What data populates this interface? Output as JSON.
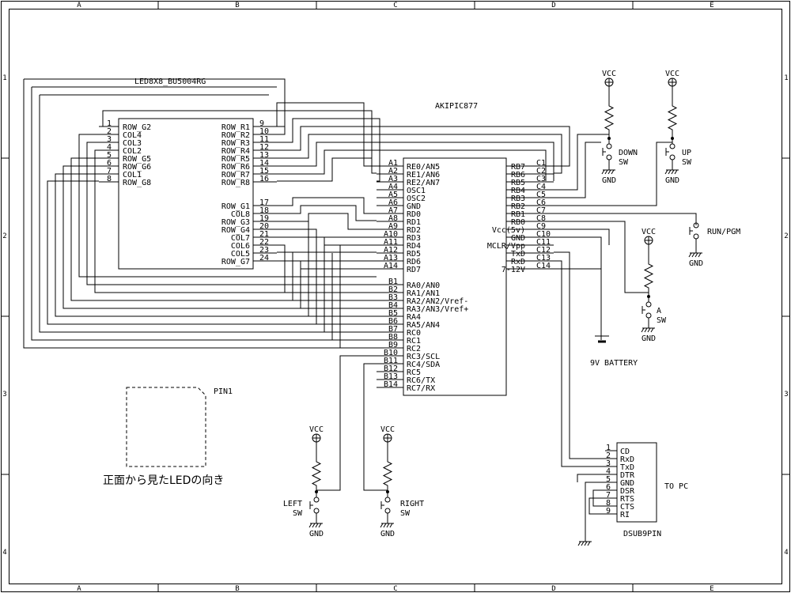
{
  "frame": {
    "cols": [
      "A",
      "B",
      "C",
      "D",
      "E"
    ],
    "rows": [
      "1",
      "2",
      "3",
      "4"
    ]
  },
  "led": {
    "title": "LED8X8_BU5004RG",
    "left_pins": [
      {
        "num": "1",
        "name": "ROW_G2"
      },
      {
        "num": "2",
        "name": "COL4"
      },
      {
        "num": "3",
        "name": "COL3"
      },
      {
        "num": "4",
        "name": "COL2"
      },
      {
        "num": "5",
        "name": "ROW_G5"
      },
      {
        "num": "6",
        "name": "ROW_G6"
      },
      {
        "num": "7",
        "name": "COL1"
      },
      {
        "num": "8",
        "name": "ROW_G8"
      }
    ],
    "right_pins_a": [
      {
        "num": "9",
        "name": "ROW_R1"
      },
      {
        "num": "10",
        "name": "ROW_R2"
      },
      {
        "num": "11",
        "name": "ROW_R3"
      },
      {
        "num": "12",
        "name": "ROW_R4"
      },
      {
        "num": "13",
        "name": "ROW_R5"
      },
      {
        "num": "14",
        "name": "ROW_R6"
      },
      {
        "num": "15",
        "name": "ROW_R7"
      },
      {
        "num": "16",
        "name": "ROW_R8"
      }
    ],
    "right_pins_b": [
      {
        "num": "17",
        "name": "ROW_G1"
      },
      {
        "num": "18",
        "name": "COL8"
      },
      {
        "num": "19",
        "name": "ROW_G3"
      },
      {
        "num": "20",
        "name": "ROW_G4"
      },
      {
        "num": "21",
        "name": "COL7"
      },
      {
        "num": "22",
        "name": "COL6"
      },
      {
        "num": "23",
        "name": "COL5"
      },
      {
        "num": "24",
        "name": "ROW_G7"
      }
    ]
  },
  "pic": {
    "title": "AKIPIC877",
    "left_a": [
      {
        "pin": "A1",
        "name": "RE0/AN5"
      },
      {
        "pin": "A2",
        "name": "RE1/AN6"
      },
      {
        "pin": "A3",
        "name": "RE2/AN7"
      },
      {
        "pin": "A4",
        "name": "OSC1"
      },
      {
        "pin": "A5",
        "name": "OSC2"
      },
      {
        "pin": "A6",
        "name": "GND"
      },
      {
        "pin": "A7",
        "name": "RD0"
      },
      {
        "pin": "A8",
        "name": "RD1"
      },
      {
        "pin": "A9",
        "name": "RD2"
      },
      {
        "pin": "A10",
        "name": "RD3"
      },
      {
        "pin": "A11",
        "name": "RD4"
      },
      {
        "pin": "A12",
        "name": "RD5"
      },
      {
        "pin": "A13",
        "name": "RD6"
      },
      {
        "pin": "A14",
        "name": "RD7"
      }
    ],
    "left_b": [
      {
        "pin": "B1",
        "name": "RA0/AN0"
      },
      {
        "pin": "B2",
        "name": "RA1/AN1"
      },
      {
        "pin": "B3",
        "name": "RA2/AN2/Vref-"
      },
      {
        "pin": "B4",
        "name": "RA3/AN3/Vref+"
      },
      {
        "pin": "B5",
        "name": "RA4"
      },
      {
        "pin": "B6",
        "name": "RA5/AN4"
      },
      {
        "pin": "B7",
        "name": "RC0"
      },
      {
        "pin": "B8",
        "name": "RC1"
      },
      {
        "pin": "B9",
        "name": "RC2"
      },
      {
        "pin": "B10",
        "name": "RC3/SCL"
      },
      {
        "pin": "B11",
        "name": "RC4/SDA"
      },
      {
        "pin": "B12",
        "name": "RC5"
      },
      {
        "pin": "B13",
        "name": "RC6/TX"
      },
      {
        "pin": "B14",
        "name": "RC7/RX"
      }
    ],
    "right": [
      {
        "pin": "C1",
        "name": "RB7"
      },
      {
        "pin": "C2",
        "name": "RB6"
      },
      {
        "pin": "C3",
        "name": "RB5"
      },
      {
        "pin": "C4",
        "name": "RB4"
      },
      {
        "pin": "C5",
        "name": "RB3"
      },
      {
        "pin": "C6",
        "name": "RB2"
      },
      {
        "pin": "C7",
        "name": "RB1"
      },
      {
        "pin": "C8",
        "name": "RB0"
      },
      {
        "pin": "C9",
        "name": "Vcc(5v)"
      },
      {
        "pin": "C10",
        "name": "GND"
      },
      {
        "pin": "C11",
        "name": "MCLR/Vpp"
      },
      {
        "pin": "C12",
        "name": "TxD"
      },
      {
        "pin": "C13",
        "name": "RxD"
      },
      {
        "pin": "C14",
        "name": "7-12V"
      }
    ]
  },
  "dsub": {
    "title": "DSUB9PIN",
    "to_pc": "TO PC",
    "pins": [
      {
        "num": "1",
        "name": "CD"
      },
      {
        "num": "2",
        "name": "RxD"
      },
      {
        "num": "3",
        "name": "TxD"
      },
      {
        "num": "4",
        "name": "DTR"
      },
      {
        "num": "5",
        "name": "GND"
      },
      {
        "num": "6",
        "name": "DSR"
      },
      {
        "num": "7",
        "name": "RTS"
      },
      {
        "num": "8",
        "name": "CTS"
      },
      {
        "num": "9",
        "name": "RI"
      }
    ]
  },
  "vcc": "VCC",
  "gnd": "GND",
  "sw": "SW",
  "switches": {
    "down": "DOWN",
    "up": "UP",
    "run": "RUN/PGM",
    "a": "A",
    "left": "LEFT",
    "right": "RIGHT"
  },
  "battery": "9V BATTERY",
  "pin1": "PIN1",
  "led_front_note": "正面から見たLEDの向き"
}
